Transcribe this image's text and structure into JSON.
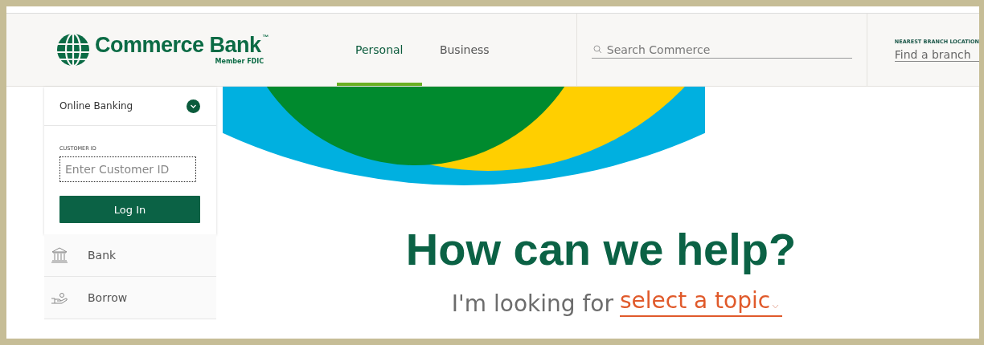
{
  "header": {
    "logo": {
      "name": "Commerce Bank",
      "trademark": "™",
      "tagline": "Member FDIC"
    },
    "nav": [
      {
        "label": "Personal",
        "selected": true
      },
      {
        "label": "Business",
        "selected": false
      }
    ],
    "search": {
      "placeholder": "Search Commerce"
    },
    "branch": {
      "label": "NEAREST BRANCH LOCATION",
      "link": "Find a branch"
    }
  },
  "login": {
    "title": "Online Banking",
    "expanded": true,
    "field_label": "CUSTOMER ID",
    "placeholder": "Enter Customer ID",
    "button": "Log In"
  },
  "menu": [
    {
      "kind": "bank",
      "label": "Bank"
    },
    {
      "kind": "borrow",
      "label": "Borrow"
    }
  ],
  "hero": {
    "heading": "How can we help?",
    "prompt": "I'm looking for",
    "topic": "select a topic"
  }
}
